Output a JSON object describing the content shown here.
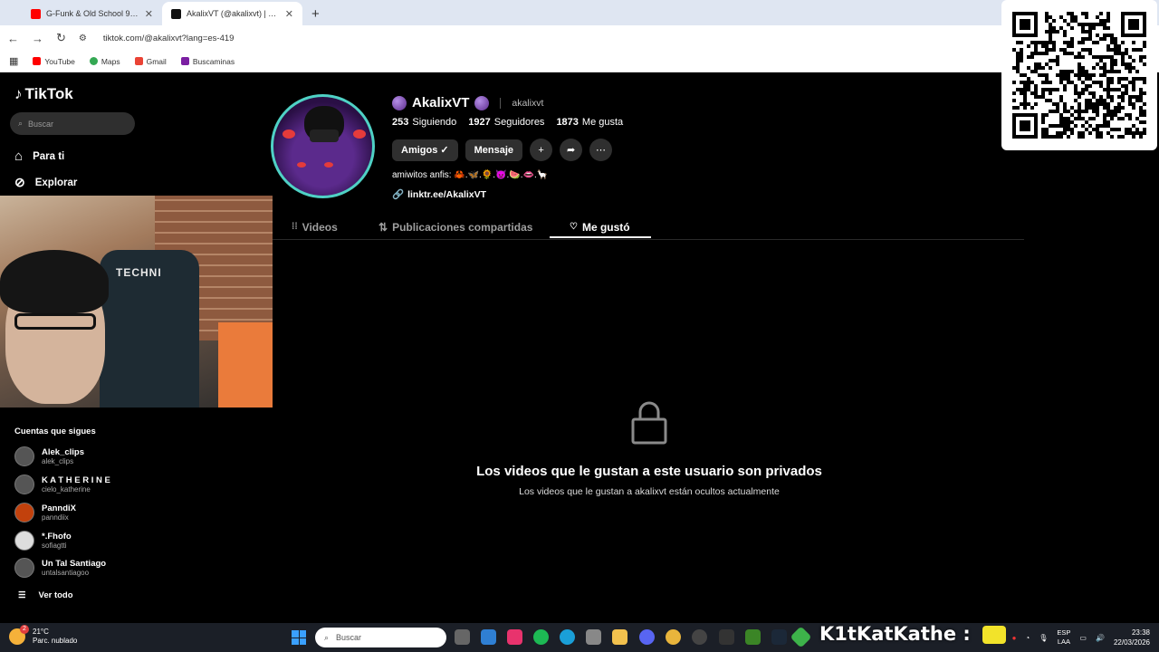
{
  "browser": {
    "tabs": [
      {
        "title": "G-Funk & Old School 90s 🎧 Sn",
        "active": false,
        "icon": "youtube-icon"
      },
      {
        "title": "AkalixVT (@akalixvt) | TikTok",
        "active": true,
        "icon": "tiktok-icon"
      }
    ],
    "url": "tiktok.com/@akalixvt?lang=es-419",
    "bookmarks": [
      {
        "label": "YouTube",
        "color": "#ff0000"
      },
      {
        "label": "Maps",
        "color": "#34a853"
      },
      {
        "label": "Gmail",
        "color": "#ea4335"
      },
      {
        "label": "Buscaminas",
        "color": "#7b1fa2"
      }
    ]
  },
  "sidebar": {
    "logo": "TikTok",
    "search_placeholder": "Buscar",
    "nav": [
      {
        "label": "Para ti",
        "icon": "home-icon"
      },
      {
        "label": "Explorar",
        "icon": "compass-icon"
      }
    ],
    "webcam_text": "TECHNI",
    "following_title": "Cuentas que sigues",
    "accounts": [
      {
        "name": "Alek_clips",
        "handle": "alek_clips"
      },
      {
        "name": "K A T H E R I N E",
        "handle": "cielo_katherine"
      },
      {
        "name": "PanndiX",
        "handle": "panndiix"
      },
      {
        "name": "*.Fhofo",
        "handle": "sofiagtti"
      },
      {
        "name": "Un Tal Santiago",
        "handle": "untalsantiagoo"
      }
    ],
    "see_all": "Ver todo"
  },
  "profile": {
    "display_name": "AkalixVT",
    "username": "akalixvt",
    "stats": [
      {
        "value": "253",
        "label": "Siguiendo"
      },
      {
        "value": "1927",
        "label": "Seguidores"
      },
      {
        "value": "1873",
        "label": "Me gusta"
      }
    ],
    "friends_label": "Amigos ✓",
    "message_label": "Mensaje",
    "bio": "amiwitos anfis: 🦀.🦋.🌻.👿.🍉.👄.🦙",
    "link": "linktr.ee/AkalixVT",
    "tabs": [
      {
        "label": "Videos",
        "icon": "grid-icon"
      },
      {
        "label": "Publicaciones compartidas",
        "icon": "repost-icon"
      },
      {
        "label": "Me gustó",
        "icon": "heart-icon"
      }
    ],
    "active_tab": "Me gustó",
    "private_title": "Los videos que le gustan a este usuario son privados",
    "private_subtitle": "Los videos que le gustan a akalixvt están ocultos actualmente"
  },
  "taskbar": {
    "weather_temp": "21°C",
    "weather_desc": "Parc. nublado",
    "weather_badge": "2",
    "search_placeholder": "Buscar",
    "overlay_name": "K1tKatKathe :",
    "lang_1": "ESP",
    "lang_2": "LAA",
    "time": "23:38",
    "date": "22/03/2026"
  },
  "colors": {
    "accent": "#fe2c55",
    "avatar_ring": "#4fd1c5",
    "background": "#000000"
  }
}
